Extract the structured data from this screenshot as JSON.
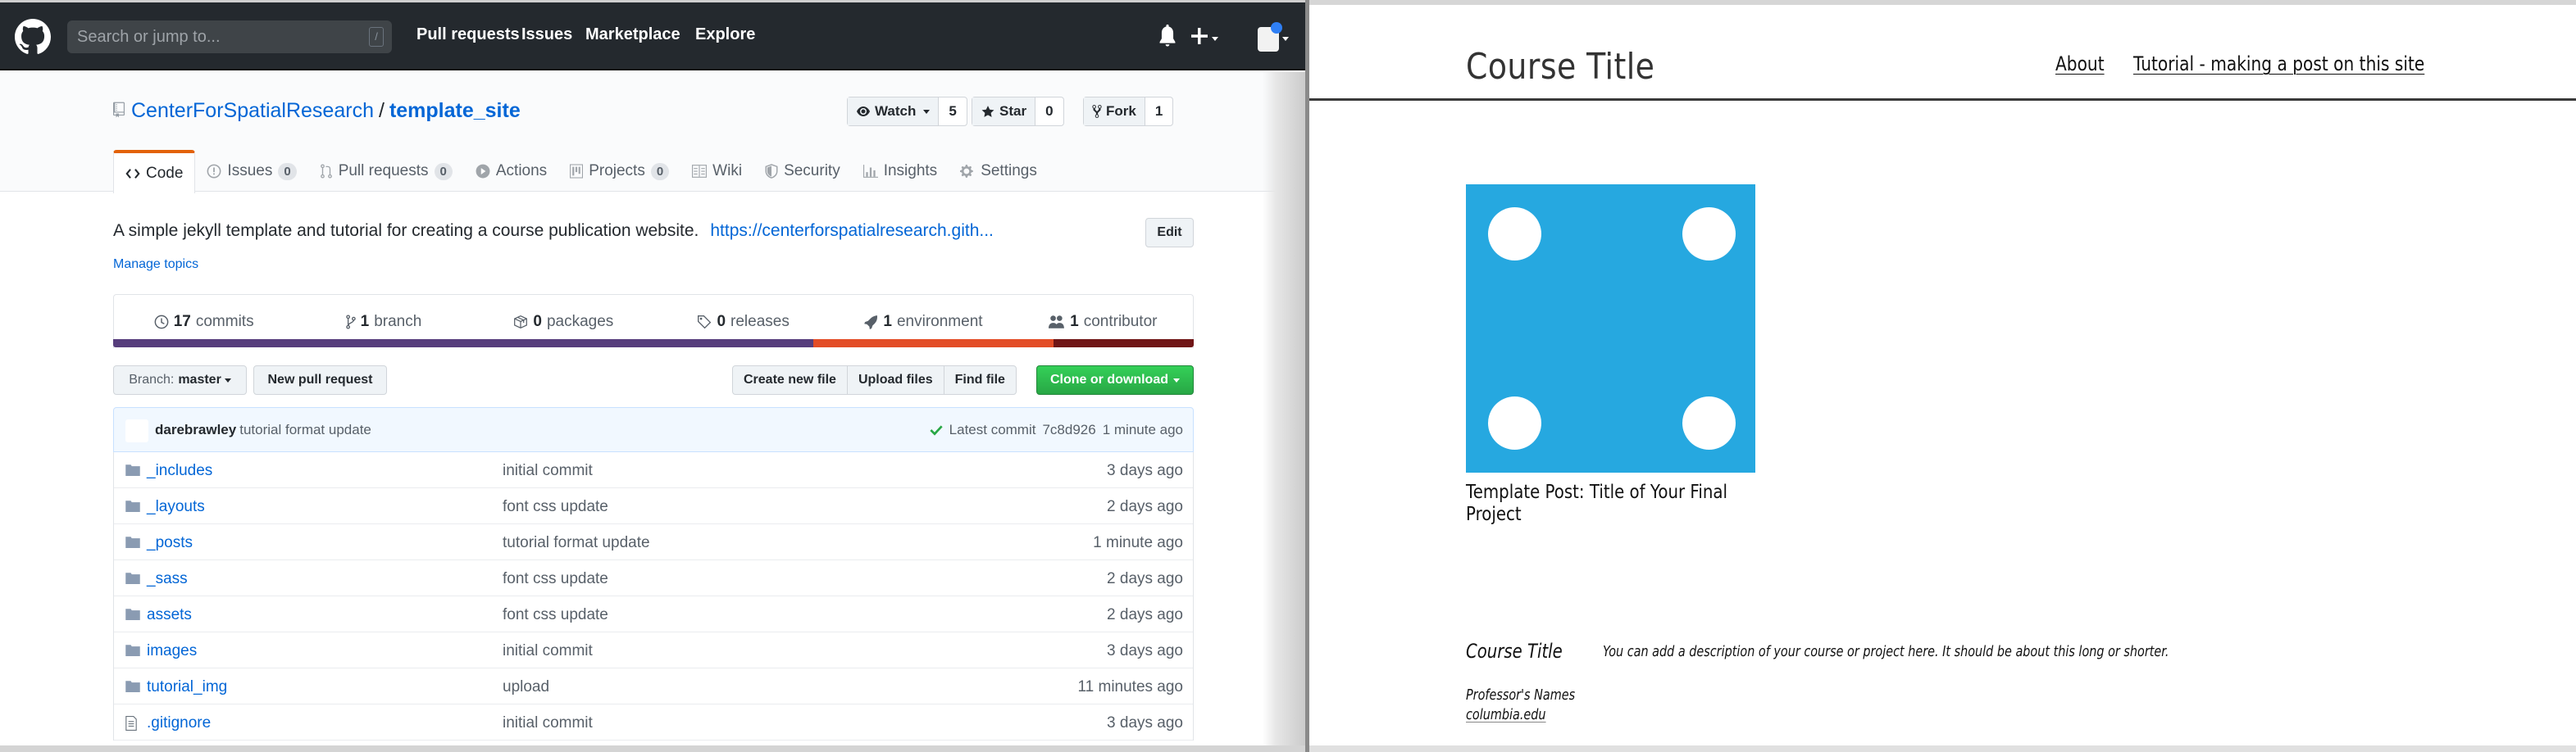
{
  "github": {
    "header": {
      "search_placeholder": "Search or jump to...",
      "search_shortcut": "/",
      "nav": [
        "Pull requests",
        "Issues",
        "Marketplace",
        "Explore"
      ],
      "icons": [
        "github-logo",
        "bell-icon",
        "plus-icon",
        "avatar"
      ]
    },
    "repo": {
      "owner": "CenterForSpatialResearch",
      "separator": "/",
      "name": "template_site",
      "watch": {
        "label": "Watch",
        "count": "5"
      },
      "star": {
        "label": "Star",
        "count": "0"
      },
      "fork": {
        "label": "Fork",
        "count": "1"
      }
    },
    "tabs": [
      {
        "label": "Code",
        "icon": "code-icon",
        "selected": true
      },
      {
        "label": "Issues",
        "counter": "0",
        "icon": "issue-icon"
      },
      {
        "label": "Pull requests",
        "counter": "0",
        "icon": "pull-request-icon"
      },
      {
        "label": "Actions",
        "icon": "play-icon"
      },
      {
        "label": "Projects",
        "counter": "0",
        "icon": "project-icon"
      },
      {
        "label": "Wiki",
        "icon": "book-icon"
      },
      {
        "label": "Security",
        "icon": "shield-icon"
      },
      {
        "label": "Insights",
        "icon": "graph-icon"
      },
      {
        "label": "Settings",
        "icon": "gear-icon"
      }
    ],
    "description": "A simple jekyll template and tutorial for creating a course publication website.",
    "homepage_link": "https://centerforspatialresearch.gith...",
    "edit_label": "Edit",
    "manage_topics": "Manage topics",
    "summary": [
      {
        "count": "17",
        "label": "commits",
        "icon": "history-icon"
      },
      {
        "count": "1",
        "label": "branch",
        "icon": "branch-icon"
      },
      {
        "count": "0",
        "label": "packages",
        "icon": "package-icon"
      },
      {
        "count": "0",
        "label": "releases",
        "icon": "tag-icon"
      },
      {
        "count": "1",
        "label": "environment",
        "icon": "rocket-icon"
      },
      {
        "count": "1",
        "label": "contributor",
        "icon": "people-icon"
      }
    ],
    "languages": [
      {
        "color": "#563d7c",
        "share": 0.648
      },
      {
        "color": "#e34c26",
        "share": 0.222
      },
      {
        "color": "#701516",
        "share": 0.13
      }
    ],
    "branch_button": {
      "prefix": "Branch:",
      "value": "master"
    },
    "new_pr_label": "New pull request",
    "file_actions": [
      "Create new file",
      "Upload files",
      "Find file"
    ],
    "clone_label": "Clone or download",
    "latest_commit": {
      "author": "darebrawley",
      "message": "tutorial format update",
      "prefix": "Latest commit",
      "sha": "7c8d926",
      "age": "1 minute ago"
    },
    "files": [
      {
        "type": "dir",
        "name": "_includes",
        "message": "initial commit",
        "age": "3 days ago"
      },
      {
        "type": "dir",
        "name": "_layouts",
        "message": "font css update",
        "age": "2 days ago"
      },
      {
        "type": "dir",
        "name": "_posts",
        "message": "tutorial format update",
        "age": "1 minute ago"
      },
      {
        "type": "dir",
        "name": "_sass",
        "message": "font css update",
        "age": "2 days ago"
      },
      {
        "type": "dir",
        "name": "assets",
        "message": "font css update",
        "age": "2 days ago"
      },
      {
        "type": "dir",
        "name": "images",
        "message": "initial commit",
        "age": "3 days ago"
      },
      {
        "type": "dir",
        "name": "tutorial_img",
        "message": "upload",
        "age": "11 minutes ago"
      },
      {
        "type": "file",
        "name": ".gitignore",
        "message": "initial commit",
        "age": "3 days ago"
      }
    ]
  },
  "site": {
    "title": "Course Title",
    "nav": [
      "About",
      "Tutorial - making a post on this site"
    ],
    "post": {
      "title": "Template Post: Title of Your Final Project",
      "thumb_color": "#26a8e0"
    },
    "footer": {
      "title": "Course Title",
      "description": "You can add a description of your course or project here. It should be about this long or shorter.",
      "professors": "Professor's Names",
      "email": "columbia.edu"
    }
  }
}
